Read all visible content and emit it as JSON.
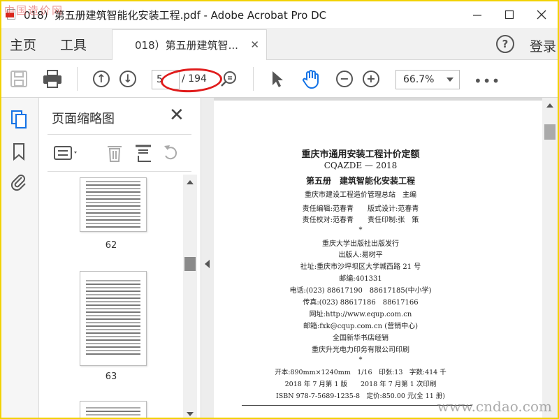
{
  "window": {
    "title": "018）第五册建筑智能化安装工程.pdf - Adobe Acrobat Pro DC",
    "watermark_top": "中国造价网",
    "controls": [
      "minimize",
      "maximize",
      "close"
    ]
  },
  "menu": {
    "home": "主页",
    "tools": "工具",
    "doc_tab": "018）第五册建筑智...",
    "login": "登录"
  },
  "toolbar": {
    "current_page": "5",
    "page_total": "/ 194",
    "zoom": "66.7%",
    "more": "•••"
  },
  "thumbnails": {
    "title": "页面缩略图",
    "pages": [
      {
        "number": "62"
      },
      {
        "number": "63"
      }
    ]
  },
  "document": {
    "lines": [
      "重庆市通用安装工程计价定额",
      "CQAZDE — 2018",
      "第五册　建筑智能化安装工程",
      "重庆市建设工程造价管理总站　主编",
      "责任编辑:范春青　　版式设计:范春青",
      "责任校对:范春青　　责任印制:张　策",
      "*",
      "重庆大学出版社出版发行",
      "出版人:易树平",
      "社址:重庆市沙坪坝区大学城西路 21 号",
      "邮编:401331",
      "电话:(023) 88617190　88617185(中小学)",
      "传真:(023) 88617186　88617166",
      "网址:http://www.equp.com.cn",
      "邮箱:fxk@cqup.com.cn (营销中心)",
      "全国新华书店经销",
      "重庆升光电力印务有限公司印刷",
      "*",
      "开本:890mm×1240mm　1/16　印张:13　字数:414 千",
      "2018 年 7 月第 1 版　　2018 年 7 月第 1 次印刷",
      "ISBN 978-7-5689-1235-8　定价:850.00 元(全 11 册)"
    ],
    "watermark": "www.cndao.com"
  },
  "colors": {
    "highlight_ring": "#e01b1b",
    "hand_tool": "#1473e6",
    "frame_border": "#f2d200"
  }
}
